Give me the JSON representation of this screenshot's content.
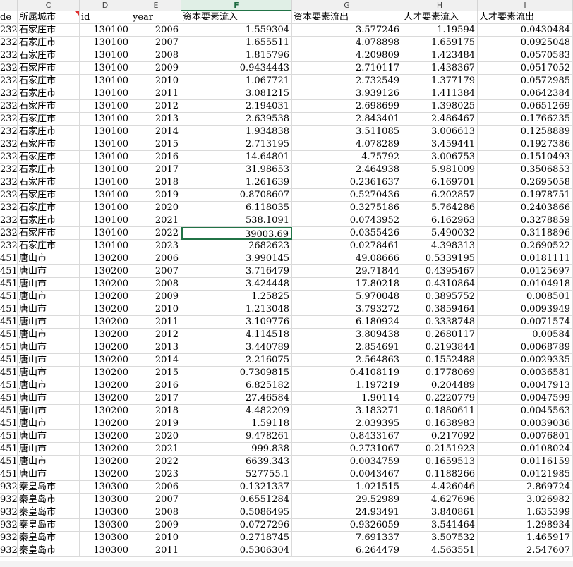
{
  "columns": [
    "C",
    "D",
    "E",
    "F",
    "G",
    "H",
    "I"
  ],
  "active_column": "F",
  "header_row": [
    "de",
    "所属城市",
    "id",
    "year",
    "资本要素流入",
    "资本要素流出",
    "人才要素流入",
    "人才要素流出"
  ],
  "selected_cell": {
    "row": 17,
    "col": "F"
  },
  "rows": [
    [
      "232",
      "石家庄市",
      "130100",
      "2006",
      "1.559304",
      "3.577246",
      "1.19594",
      "0.0430484"
    ],
    [
      "232",
      "石家庄市",
      "130100",
      "2007",
      "1.655511",
      "4.078898",
      "1.659175",
      "0.0925048"
    ],
    [
      "232",
      "石家庄市",
      "130100",
      "2008",
      "1.815796",
      "4.209809",
      "1.423484",
      "0.0570583"
    ],
    [
      "232",
      "石家庄市",
      "130100",
      "2009",
      "0.9434443",
      "2.710117",
      "1.438367",
      "0.0517052"
    ],
    [
      "232",
      "石家庄市",
      "130100",
      "2010",
      "1.067721",
      "2.732549",
      "1.377179",
      "0.0572985"
    ],
    [
      "232",
      "石家庄市",
      "130100",
      "2011",
      "3.081215",
      "3.939126",
      "1.411384",
      "0.0642384"
    ],
    [
      "232",
      "石家庄市",
      "130100",
      "2012",
      "2.194031",
      "2.698699",
      "1.398025",
      "0.0651269"
    ],
    [
      "232",
      "石家庄市",
      "130100",
      "2013",
      "2.639538",
      "2.843401",
      "2.486467",
      "0.1766235"
    ],
    [
      "232",
      "石家庄市",
      "130100",
      "2014",
      "1.934838",
      "3.511085",
      "3.006613",
      "0.1258889"
    ],
    [
      "232",
      "石家庄市",
      "130100",
      "2015",
      "2.713195",
      "4.078289",
      "3.459441",
      "0.1927386"
    ],
    [
      "232",
      "石家庄市",
      "130100",
      "2016",
      "14.64801",
      "4.75792",
      "3.006753",
      "0.1510493"
    ],
    [
      "232",
      "石家庄市",
      "130100",
      "2017",
      "31.98653",
      "2.464938",
      "5.981009",
      "0.3506853"
    ],
    [
      "232",
      "石家庄市",
      "130100",
      "2018",
      "1.261639",
      "0.2361637",
      "6.169701",
      "0.2695058"
    ],
    [
      "232",
      "石家庄市",
      "130100",
      "2019",
      "0.8708607",
      "0.5270436",
      "6.202857",
      "0.1978751"
    ],
    [
      "232",
      "石家庄市",
      "130100",
      "2020",
      "6.118035",
      "0.3275186",
      "5.764286",
      "0.2403866"
    ],
    [
      "232",
      "石家庄市",
      "130100",
      "2021",
      "538.1091",
      "0.0743952",
      "6.162963",
      "0.3278859"
    ],
    [
      "232",
      "石家庄市",
      "130100",
      "2022",
      "39003.69",
      "0.0355426",
      "5.490032",
      "0.3118896"
    ],
    [
      "232",
      "石家庄市",
      "130100",
      "2023",
      "2682623",
      "0.0278461",
      "4.398313",
      "0.2690522"
    ],
    [
      "451",
      "唐山市",
      "130200",
      "2006",
      "3.990145",
      "49.08666",
      "0.5339195",
      "0.0181111"
    ],
    [
      "451",
      "唐山市",
      "130200",
      "2007",
      "3.716479",
      "29.71844",
      "0.4395467",
      "0.0125697"
    ],
    [
      "451",
      "唐山市",
      "130200",
      "2008",
      "3.424448",
      "17.80218",
      "0.4310864",
      "0.0104918"
    ],
    [
      "451",
      "唐山市",
      "130200",
      "2009",
      "1.25825",
      "5.970048",
      "0.3895752",
      "0.008501"
    ],
    [
      "451",
      "唐山市",
      "130200",
      "2010",
      "1.213048",
      "3.793272",
      "0.3859464",
      "0.0093949"
    ],
    [
      "451",
      "唐山市",
      "130200",
      "2011",
      "3.109776",
      "6.180924",
      "0.3338748",
      "0.0071574"
    ],
    [
      "451",
      "唐山市",
      "130200",
      "2012",
      "4.114518",
      "3.809438",
      "0.2680117",
      "0.00584"
    ],
    [
      "451",
      "唐山市",
      "130200",
      "2013",
      "3.440789",
      "2.854691",
      "0.2193844",
      "0.0068789"
    ],
    [
      "451",
      "唐山市",
      "130200",
      "2014",
      "2.216075",
      "2.564863",
      "0.1552488",
      "0.0029335"
    ],
    [
      "451",
      "唐山市",
      "130200",
      "2015",
      "0.7309815",
      "0.4108119",
      "0.1778069",
      "0.0036581"
    ],
    [
      "451",
      "唐山市",
      "130200",
      "2016",
      "6.825182",
      "1.197219",
      "0.204489",
      "0.0047913"
    ],
    [
      "451",
      "唐山市",
      "130200",
      "2017",
      "27.46584",
      "1.90114",
      "0.2220779",
      "0.0047599"
    ],
    [
      "451",
      "唐山市",
      "130200",
      "2018",
      "4.482209",
      "3.183271",
      "0.1880611",
      "0.0045563"
    ],
    [
      "451",
      "唐山市",
      "130200",
      "2019",
      "1.59118",
      "2.039395",
      "0.1638983",
      "0.0039036"
    ],
    [
      "451",
      "唐山市",
      "130200",
      "2020",
      "9.478261",
      "0.8433167",
      "0.217092",
      "0.0076801"
    ],
    [
      "451",
      "唐山市",
      "130200",
      "2021",
      "999.838",
      "0.2731067",
      "0.2151923",
      "0.0108024"
    ],
    [
      "451",
      "唐山市",
      "130200",
      "2022",
      "6639.343",
      "0.0034759",
      "0.1659513",
      "0.0116159"
    ],
    [
      "451",
      "唐山市",
      "130200",
      "2023",
      "527755.1",
      "0.0043467",
      "0.1188266",
      "0.0121985"
    ],
    [
      "932",
      "秦皇岛市",
      "130300",
      "2006",
      "0.1321337",
      "1.021515",
      "4.426046",
      "2.869724"
    ],
    [
      "932",
      "秦皇岛市",
      "130300",
      "2007",
      "0.6551284",
      "29.52989",
      "4.627696",
      "3.026982"
    ],
    [
      "932",
      "秦皇岛市",
      "130300",
      "2008",
      "0.5086495",
      "24.93491",
      "3.840861",
      "1.635399"
    ],
    [
      "932",
      "秦皇岛市",
      "130300",
      "2009",
      "0.0727296",
      "0.9326059",
      "3.541464",
      "1.298934"
    ],
    [
      "932",
      "秦皇岛市",
      "130300",
      "2010",
      "0.2718745",
      "7.691337",
      "3.507532",
      "1.465917"
    ],
    [
      "932",
      "秦皇岛市",
      "130300",
      "2011",
      "0.5306304",
      "6.264479",
      "4.563551",
      "2.547607"
    ]
  ]
}
